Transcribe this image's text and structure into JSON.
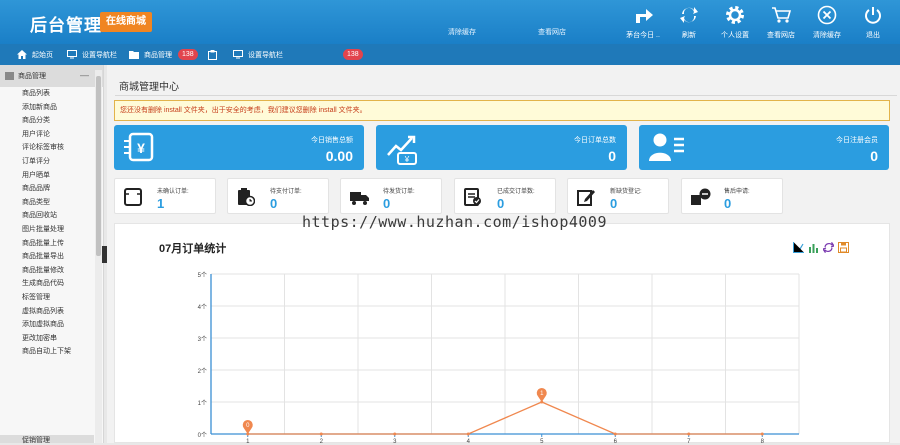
{
  "header": {
    "logo": "后台管理",
    "shop_badge": "在线商城",
    "link_clear_cache": "清除缓存",
    "link_view_shop": "查看网店",
    "icons": [
      {
        "name": "back-icon",
        "label": "茅台今日 .."
      },
      {
        "name": "refresh-icon",
        "label": "刷新"
      },
      {
        "name": "gear-icon",
        "label": "个人设置"
      },
      {
        "name": "cart-icon",
        "label": "查看网店"
      },
      {
        "name": "close-icon",
        "label": "清除缓存"
      },
      {
        "name": "power-icon",
        "label": "退出"
      }
    ]
  },
  "tabs": {
    "home": "起始页",
    "settings_nav": "设置导航栏",
    "product_manage": "商品管理",
    "badge1": "138",
    "settings_nav2": "设置导航栏",
    "badge2": "138"
  },
  "sidebar": {
    "title": "商品管理",
    "items": [
      "商品列表",
      "添加新商品",
      "商品分类",
      "用户评论",
      "评论标签审核",
      "订单评分",
      "用户晒单",
      "商品品牌",
      "商品类型",
      "商品回收站",
      "图片批量处理",
      "商品批量上传",
      "商品批量导出",
      "商品批量修改",
      "生成商品代码",
      "标签管理",
      "虚拟商品列表",
      "添加虚拟商品",
      "更改加密串",
      "商品自动上下架"
    ],
    "footer": "促销管理"
  },
  "main": {
    "title": "商城管理中心",
    "warning": "您还没有删除 install 文件夹，出于安全的考虑，我们建议您删除 install 文件夹。",
    "stats": [
      {
        "label": "今日销售总额",
        "value": "0.00"
      },
      {
        "label": "今日订单总数",
        "value": "0"
      },
      {
        "label": "今日注册会员",
        "value": "0"
      }
    ],
    "minis": [
      {
        "label": "未确认订单:",
        "value": "1"
      },
      {
        "label": "待支付订单:",
        "value": "0"
      },
      {
        "label": "待发货订单:",
        "value": "0"
      },
      {
        "label": "已成交订单数:",
        "value": "0"
      },
      {
        "label": "新缺货登记:",
        "value": "0"
      },
      {
        "label": "售后申请:",
        "value": "0"
      }
    ],
    "watermark": "https://www.huzhan.com/ishop4009",
    "chart_title": "07月订单统计"
  },
  "colors": {
    "primary": "#2b9de0",
    "line": "#f0884f",
    "header": "#1f84cc"
  },
  "chart_data": {
    "type": "line",
    "title": "07月订单统计",
    "x": [
      1,
      2,
      3,
      4,
      5,
      6,
      7,
      8
    ],
    "series": [
      {
        "values": [
          0,
          0,
          0,
          0,
          1,
          0,
          0,
          0
        ]
      }
    ],
    "ylim": [
      0,
      5
    ],
    "yticks": [
      "0个",
      "1个",
      "2个",
      "3个",
      "4个",
      "5个"
    ],
    "point_labels": [
      {
        "x": 1,
        "text": "0"
      },
      {
        "x": 5,
        "text": "1"
      }
    ],
    "grid": true
  }
}
